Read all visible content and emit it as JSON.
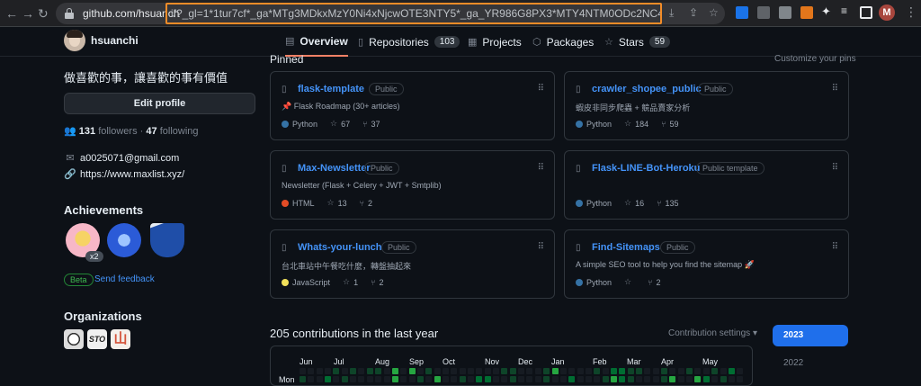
{
  "browser": {
    "url_host": "github.com/hsuanch",
    "url_rest": "i/?_gl=1*1tur7cf*_ga*MTg3MDkxMzY0Ni4xNjcwOTE3NTY5*_ga_YR986G8PX3*MTY4NTM0ODc2NC4xOTcuMS4x...",
    "profile_initial": "M",
    "highlight_color": "#f28c28"
  },
  "header": {
    "username": "hsuanchi",
    "tabs": [
      {
        "label": "Overview",
        "icon": "book-icon",
        "active": true
      },
      {
        "label": "Repositories",
        "icon": "repo-icon",
        "count": "103"
      },
      {
        "label": "Projects",
        "icon": "table-icon"
      },
      {
        "label": "Packages",
        "icon": "package-icon"
      },
      {
        "label": "Stars",
        "icon": "star-icon",
        "count": "59"
      }
    ]
  },
  "sidebar": {
    "bio": "做喜歡的事，讓喜歡的事有價值",
    "edit_profile": "Edit profile",
    "followers_count": "131",
    "followers_label": "followers",
    "separator": "·",
    "following_count": "47",
    "following_label": "following",
    "email": "a0025071@gmail.com",
    "website": "https://www.maxlist.xyz/",
    "achievements_title": "Achievements",
    "achievement_multiplier": "x2",
    "beta": "Beta",
    "send_feedback": "Send feedback",
    "organizations_title": "Organizations",
    "org_labels": [
      "STO",
      "山"
    ]
  },
  "pinned": {
    "title": "Pinned",
    "customize": "Customize your pins",
    "repos": [
      {
        "name": "flask-template",
        "visibility": "Public",
        "desc": "📌 Flask Roadmap (30+ articles)",
        "lang": "Python",
        "lang_color": "#3572A5",
        "stars": "67",
        "forks": "37"
      },
      {
        "name": "crawler_shopee_public",
        "visibility": "Public",
        "desc": "蝦皮非同步爬蟲 + 競品賣家分析",
        "lang": "Python",
        "lang_color": "#3572A5",
        "stars": "184",
        "forks": "59"
      },
      {
        "name": "Max-Newsletter",
        "visibility": "Public",
        "desc": "Newsletter (Flask + Celery + JWT + Smtplib)",
        "lang": "HTML",
        "lang_color": "#e34c26",
        "stars": "13",
        "forks": "2"
      },
      {
        "name": "Flask-LINE-Bot-Heroku",
        "visibility": "Public template",
        "desc": "",
        "lang": "Python",
        "lang_color": "#3572A5",
        "stars": "16",
        "forks": "135"
      },
      {
        "name": "Whats-your-lunch",
        "visibility": "Public",
        "desc": "台北車站中午餐吃什麼，轉盤抽起來",
        "lang": "JavaScript",
        "lang_color": "#f1e05a",
        "stars": "1",
        "forks": "2"
      },
      {
        "name": "Find-Sitemaps",
        "visibility": "Public",
        "desc": "A simple SEO tool to help you find the sitemap 🚀",
        "lang": "Python",
        "lang_color": "#3572A5",
        "stars": "",
        "forks": "2"
      }
    ]
  },
  "contributions": {
    "title": "205 contributions in the last year",
    "settings": "Contribution settings ▾",
    "months": [
      "Jun",
      "Jul",
      "Aug",
      "Sep",
      "Oct",
      "Nov",
      "Dec",
      "Jan",
      "Feb",
      "Mar",
      "Apr",
      "May"
    ],
    "day_label": "Mon",
    "years": [
      "2023",
      "2022"
    ]
  }
}
